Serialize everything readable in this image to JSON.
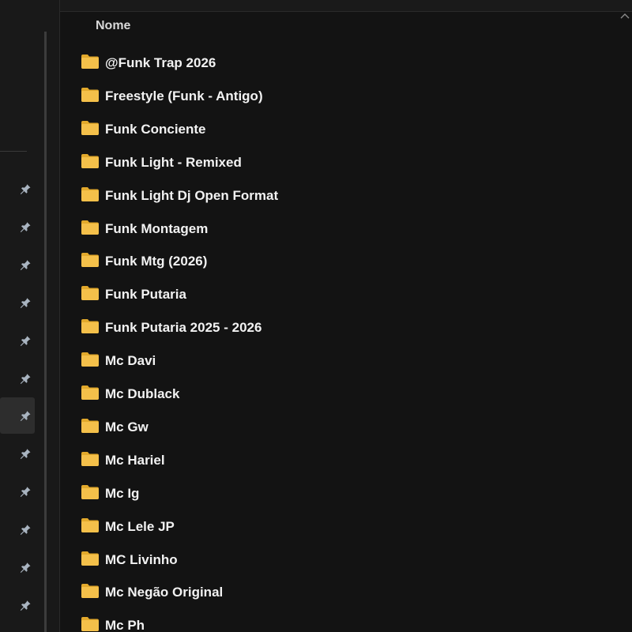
{
  "header": {
    "name_column": "Nome"
  },
  "sidebar": {
    "pins": [
      {
        "icon": "pin-icon",
        "selected": false
      },
      {
        "icon": "pin-icon",
        "selected": false
      },
      {
        "icon": "pin-icon",
        "selected": false
      },
      {
        "icon": "pin-icon",
        "selected": false
      },
      {
        "icon": "pin-icon",
        "selected": false
      },
      {
        "icon": "pin-icon",
        "selected": false
      },
      {
        "icon": "pin-icon",
        "selected": true
      },
      {
        "icon": "pin-icon",
        "selected": false
      },
      {
        "icon": "pin-icon",
        "selected": false
      },
      {
        "icon": "pin-icon",
        "selected": false
      },
      {
        "icon": "pin-icon",
        "selected": false
      },
      {
        "icon": "pin-icon",
        "selected": false
      }
    ]
  },
  "files": [
    {
      "name": "@Funk Trap 2026",
      "icon": "folder-icon"
    },
    {
      "name": "Freestyle (Funk - Antigo)",
      "icon": "folder-icon"
    },
    {
      "name": "Funk Conciente",
      "icon": "folder-icon"
    },
    {
      "name": "Funk Light - Remixed",
      "icon": "folder-icon"
    },
    {
      "name": "Funk Light Dj Open Format",
      "icon": "folder-icon"
    },
    {
      "name": "Funk Montagem",
      "icon": "folder-icon"
    },
    {
      "name": "Funk Mtg (2026)",
      "icon": "folder-icon"
    },
    {
      "name": "Funk Putaria",
      "icon": "folder-icon"
    },
    {
      "name": "Funk Putaria 2025 - 2026",
      "icon": "folder-icon"
    },
    {
      "name": "Mc Davi",
      "icon": "folder-icon"
    },
    {
      "name": "Mc Dublack",
      "icon": "folder-icon"
    },
    {
      "name": "Mc Gw",
      "icon": "folder-icon"
    },
    {
      "name": "Mc Hariel",
      "icon": "folder-icon"
    },
    {
      "name": "Mc Ig",
      "icon": "folder-icon"
    },
    {
      "name": "Mc Lele JP",
      "icon": "folder-icon"
    },
    {
      "name": "MC Livinho",
      "icon": "folder-icon"
    },
    {
      "name": "Mc Negão Original",
      "icon": "folder-icon"
    },
    {
      "name": "Mc Ph",
      "icon": "folder-icon"
    }
  ],
  "colors": {
    "background": "#131313",
    "sidebar": "#191919",
    "folder_yellow": "#f4c04a",
    "folder_dark": "#e2a92c",
    "text": "#f2f2f2",
    "pin": "#a9b4c0"
  }
}
